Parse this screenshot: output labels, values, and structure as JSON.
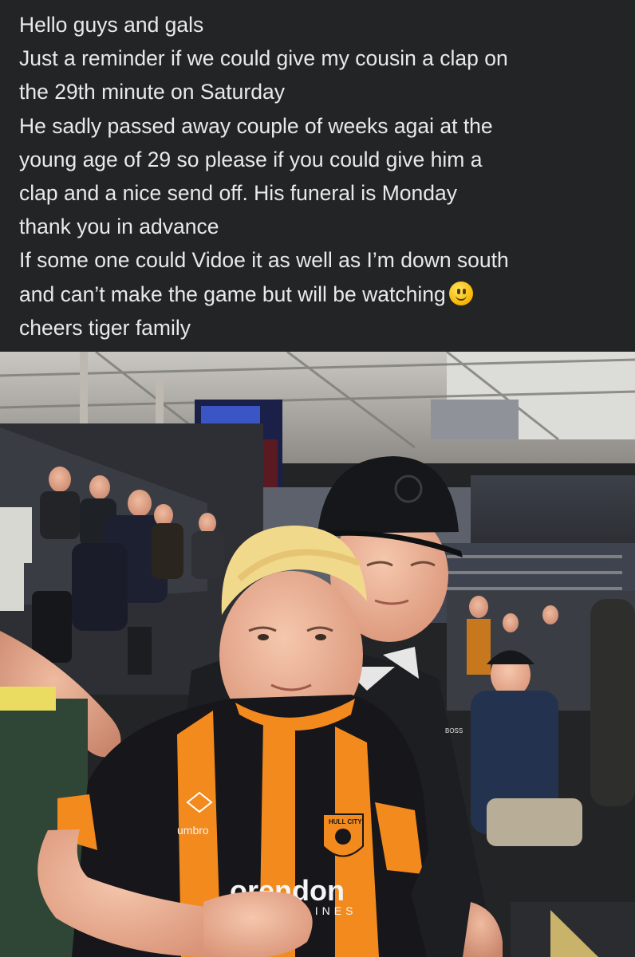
{
  "post": {
    "lines": [
      "Hello guys and gals",
      "Just a reminder if we could give my cousin a clap on",
      "the 29th minute on Saturday",
      "He sadly passed away couple of weeks agai at the",
      "young age of 29 so please if you could give him a",
      "clap and a nice send off. His funeral is Monday",
      "thank you in advance",
      "If some one could Vidoe it as well as I’m down south",
      "and can’t make the game but will be watching",
      "cheers tiger family"
    ],
    "emoji": "smiling-face-icon"
  },
  "photo": {
    "shirt_sponsor": "orendon",
    "shirt_sponsor_sub": "IRLINES",
    "shirt_brand": "umbro",
    "badge_text": "HULL CITY",
    "polo_brand": "BOSS"
  },
  "colors": {
    "background": "#232425",
    "text": "#e9e9ea",
    "shirt_orange": "#f28a1e",
    "shirt_black": "#17161a"
  }
}
